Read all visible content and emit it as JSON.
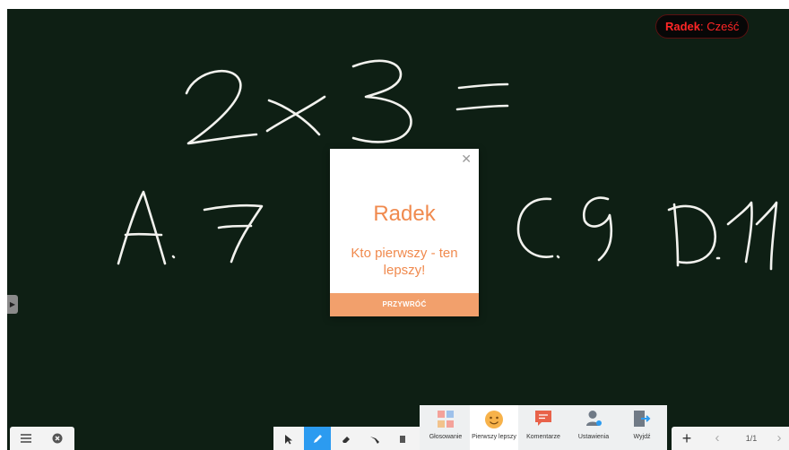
{
  "chat": {
    "sender": "Radek",
    "message": "Cześć"
  },
  "modal": {
    "name": "Radek",
    "message": "Kto pierwszy - ten lepszy!",
    "button_label": "PRZYWRÓĆ",
    "close_icon": "close-icon"
  },
  "left_toolbar": {
    "icons": [
      "hamburger-menu-icon",
      "close-circle-icon"
    ]
  },
  "tools": [
    {
      "icon": "cursor-arrow-icon",
      "active": false
    },
    {
      "icon": "pen-icon",
      "active": true
    },
    {
      "icon": "eraser-icon",
      "active": false
    },
    {
      "icon": "highlighter-icon",
      "active": false
    },
    {
      "icon": "laser-icon",
      "active": false
    }
  ],
  "menu": {
    "items": [
      {
        "label": "Głosowanie",
        "icon": "voting-icon",
        "selected": false
      },
      {
        "label": "Pierwszy lepszy",
        "icon": "smiley-face-icon",
        "selected": true
      },
      {
        "label": "Komentarze",
        "icon": "comment-icon",
        "selected": false
      },
      {
        "label": "Ustawienia",
        "icon": "user-settings-icon",
        "selected": false
      },
      {
        "label": "Wyjdź",
        "icon": "exit-icon",
        "selected": false
      }
    ]
  },
  "pager": {
    "add_icon": "plus-icon",
    "prev_icon": "chevron-left-icon",
    "page": "1/1",
    "next_icon": "chevron-right-icon"
  },
  "colors": {
    "board": "#0e1f14",
    "chalk": "#f2f2ee",
    "accent": "#f08a4e",
    "chat_text": "#ff2626",
    "tool_active": "#2c9bf0"
  }
}
